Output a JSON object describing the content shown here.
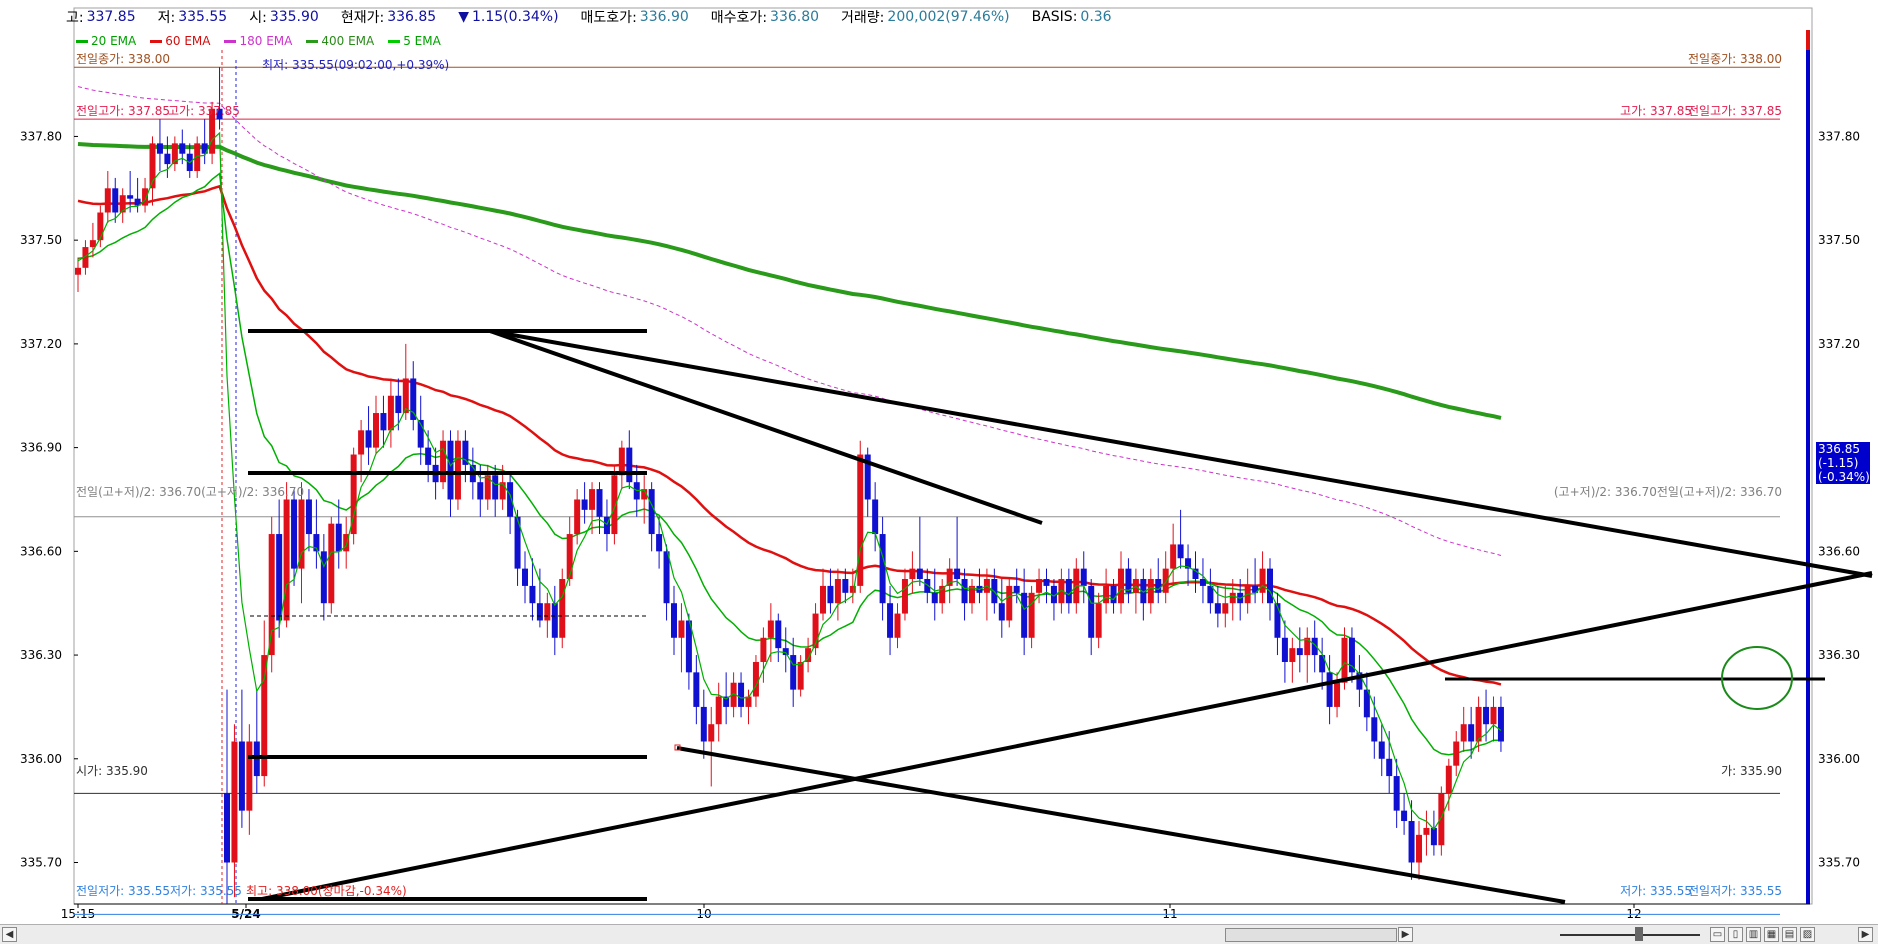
{
  "infobar": {
    "high_label": "고:",
    "high_value": "337.85",
    "low_label": "저:",
    "low_value": "335.55",
    "open_label": "시:",
    "open_value": "335.90",
    "current_label": "현재가:",
    "current_value": "336.85",
    "change_icon": "down-triangle-icon",
    "change_value": "1.15(0.34%)",
    "ask_label": "매도호가:",
    "ask_value": "336.90",
    "bid_label": "매수호가:",
    "bid_value": "336.80",
    "volume_label": "거래량:",
    "volume_value": "200,002(97.46%)",
    "basis_label": "BASIS:",
    "basis_value": "0.36"
  },
  "legend": [
    {
      "label": "20 EMA",
      "color": "#00b000"
    },
    {
      "label": "60 EMA",
      "color": "#e01010"
    },
    {
      "label": "180 EMA",
      "color": "#cc33cc"
    },
    {
      "label": "400 EMA",
      "color": "#2a9a1a"
    },
    {
      "label": "5 EMA",
      "color": "#00cc00"
    }
  ],
  "colors": {
    "up": "#e0101a",
    "down": "#1010d0",
    "ema20": "#00b000",
    "ema60": "#e01010",
    "ema180": "#cc33cc",
    "ema400": "#2a9a1a",
    "accent": "#0000cc"
  },
  "price_box": {
    "line1": "336.85",
    "line2": "(-1.15)",
    "line3": "(-0.34%)"
  },
  "annotations": {
    "min_marker": "최저: 335.55(09:02:00,+0.39%)",
    "prev_close_left": "전일종가: 338.00",
    "prev_close_right": "전일종가: 338.00",
    "prev_high_left": "전일고가: 337.85",
    "high_left": "고가: 337.85",
    "high_right": "고가: 337.85",
    "prev_high_right": "전일고가: 337.85",
    "mid_left": "전일(고+저)/2: 336.70(고+저)/2: 336.70",
    "mid_right": "(고+저)/2: 336.70전일(고+저)/2: 336.70",
    "open_left": "시가: 335.90",
    "open_right": "가: 335.90",
    "prev_low_left": "전일저가: 335.55",
    "low_left": "저가: 335.55",
    "max_label": "최고: 338.00(장마감,-0.34%)",
    "low_right": "저가: 335.55",
    "prev_low_right": "전일저가: 335.55"
  },
  "chart_data": {
    "type": "candlestick",
    "instrument_timeframe": "1-minute",
    "x_tick_labels": [
      "15:15",
      "5/24",
      "10",
      "11",
      "12"
    ],
    "y_tick_labels": [
      "337.80",
      "337.50",
      "337.20",
      "336.90",
      "336.60",
      "336.30",
      "336.00",
      "335.70"
    ],
    "ylim": [
      335.58,
      338.05
    ],
    "reference_lines": {
      "prev_close": 338.0,
      "high": 337.85,
      "mid": 336.7,
      "open": 335.9,
      "low": 335.55
    },
    "current_price": 336.85,
    "session_start_index": 20,
    "candles": [
      [
        337.4,
        337.45,
        337.35,
        337.42
      ],
      [
        337.42,
        337.5,
        337.4,
        337.48
      ],
      [
        337.48,
        337.55,
        337.45,
        337.5
      ],
      [
        337.5,
        337.6,
        337.48,
        337.58
      ],
      [
        337.58,
        337.7,
        337.55,
        337.65
      ],
      [
        337.65,
        337.68,
        337.55,
        337.58
      ],
      [
        337.58,
        337.65,
        337.55,
        337.63
      ],
      [
        337.63,
        337.7,
        337.58,
        337.62
      ],
      [
        337.62,
        337.68,
        337.58,
        337.6
      ],
      [
        337.6,
        337.68,
        337.58,
        337.65
      ],
      [
        337.65,
        337.8,
        337.6,
        337.78
      ],
      [
        337.78,
        337.85,
        337.7,
        337.75
      ],
      [
        337.75,
        337.8,
        337.68,
        337.72
      ],
      [
        337.72,
        337.8,
        337.7,
        337.78
      ],
      [
        337.78,
        337.82,
        337.72,
        337.75
      ],
      [
        337.75,
        337.78,
        337.68,
        337.7
      ],
      [
        337.7,
        337.8,
        337.68,
        337.78
      ],
      [
        337.78,
        337.85,
        337.72,
        337.75
      ],
      [
        337.75,
        337.9,
        337.72,
        337.88
      ],
      [
        337.88,
        338.0,
        337.82,
        337.85
      ],
      [
        335.9,
        336.2,
        335.58,
        335.7
      ],
      [
        335.7,
        336.1,
        335.6,
        336.05
      ],
      [
        336.05,
        336.2,
        335.8,
        335.85
      ],
      [
        335.85,
        336.1,
        335.78,
        336.05
      ],
      [
        336.05,
        336.2,
        335.9,
        335.95
      ],
      [
        335.95,
        336.4,
        335.92,
        336.3
      ],
      [
        336.3,
        336.7,
        336.25,
        336.65
      ],
      [
        336.65,
        336.75,
        336.35,
        336.4
      ],
      [
        336.4,
        336.8,
        336.38,
        336.75
      ],
      [
        336.75,
        336.78,
        336.5,
        336.55
      ],
      [
        336.55,
        336.8,
        336.45,
        336.75
      ],
      [
        336.75,
        336.78,
        336.6,
        336.65
      ],
      [
        336.65,
        336.75,
        336.55,
        336.6
      ],
      [
        336.6,
        336.65,
        336.4,
        336.45
      ],
      [
        336.45,
        336.7,
        336.42,
        336.68
      ],
      [
        336.68,
        336.75,
        336.55,
        336.6
      ],
      [
        336.6,
        336.7,
        336.55,
        336.65
      ],
      [
        336.65,
        336.9,
        336.62,
        336.88
      ],
      [
        336.88,
        336.98,
        336.8,
        336.95
      ],
      [
        336.95,
        337.02,
        336.85,
        336.9
      ],
      [
        336.9,
        337.05,
        336.88,
        337.0
      ],
      [
        337.0,
        337.05,
        336.9,
        336.95
      ],
      [
        336.95,
        337.1,
        336.9,
        337.05
      ],
      [
        337.05,
        337.1,
        336.95,
        337.0
      ],
      [
        337.0,
        337.2,
        336.98,
        337.1
      ],
      [
        337.1,
        337.15,
        336.95,
        336.98
      ],
      [
        336.98,
        337.05,
        336.85,
        336.9
      ],
      [
        336.9,
        336.95,
        336.8,
        336.85
      ],
      [
        336.85,
        336.9,
        336.75,
        336.8
      ],
      [
        336.8,
        336.95,
        336.78,
        336.92
      ],
      [
        336.92,
        336.95,
        336.7,
        336.75
      ],
      [
        336.75,
        336.95,
        336.72,
        336.92
      ],
      [
        336.92,
        336.95,
        336.8,
        336.85
      ],
      [
        336.85,
        336.9,
        336.75,
        336.8
      ],
      [
        336.8,
        336.85,
        336.7,
        336.75
      ],
      [
        336.75,
        336.85,
        336.72,
        336.82
      ],
      [
        336.82,
        336.85,
        336.7,
        336.75
      ],
      [
        336.75,
        336.85,
        336.72,
        336.8
      ],
      [
        336.8,
        336.82,
        336.65,
        336.7
      ],
      [
        336.7,
        336.72,
        336.5,
        336.55
      ],
      [
        336.55,
        336.6,
        336.45,
        336.5
      ],
      [
        336.5,
        336.58,
        336.4,
        336.45
      ],
      [
        336.45,
        336.55,
        336.38,
        336.4
      ],
      [
        336.4,
        336.48,
        336.35,
        336.45
      ],
      [
        336.45,
        336.5,
        336.3,
        336.35
      ],
      [
        336.35,
        336.55,
        336.32,
        336.52
      ],
      [
        336.52,
        336.7,
        336.5,
        336.65
      ],
      [
        336.65,
        336.78,
        336.62,
        336.75
      ],
      [
        336.75,
        336.8,
        336.68,
        336.72
      ],
      [
        336.72,
        336.8,
        336.65,
        336.78
      ],
      [
        336.78,
        336.8,
        336.65,
        336.7
      ],
      [
        336.7,
        336.75,
        336.6,
        336.65
      ],
      [
        336.65,
        336.85,
        336.62,
        336.82
      ],
      [
        336.82,
        336.92,
        336.78,
        336.9
      ],
      [
        336.9,
        336.95,
        336.78,
        336.8
      ],
      [
        336.8,
        336.85,
        336.7,
        336.75
      ],
      [
        336.75,
        336.82,
        336.68,
        336.78
      ],
      [
        336.78,
        336.8,
        336.6,
        336.65
      ],
      [
        336.65,
        336.7,
        336.55,
        336.6
      ],
      [
        336.6,
        336.62,
        336.4,
        336.45
      ],
      [
        336.45,
        336.5,
        336.3,
        336.35
      ],
      [
        336.35,
        336.45,
        336.25,
        336.4
      ],
      [
        336.4,
        336.42,
        336.2,
        336.25
      ],
      [
        336.25,
        336.3,
        336.1,
        336.15
      ],
      [
        336.15,
        336.2,
        336.0,
        336.05
      ],
      [
        336.05,
        336.15,
        335.92,
        336.1
      ],
      [
        336.1,
        336.22,
        336.05,
        336.18
      ],
      [
        336.18,
        336.25,
        336.1,
        336.15
      ],
      [
        336.15,
        336.25,
        336.12,
        336.22
      ],
      [
        336.22,
        336.25,
        336.12,
        336.15
      ],
      [
        336.15,
        336.2,
        336.1,
        336.18
      ],
      [
        336.18,
        336.3,
        336.15,
        336.28
      ],
      [
        336.28,
        336.38,
        336.22,
        336.35
      ],
      [
        336.35,
        336.45,
        336.28,
        336.4
      ],
      [
        336.4,
        336.42,
        336.28,
        336.32
      ],
      [
        336.32,
        336.38,
        336.25,
        336.3
      ],
      [
        336.3,
        336.35,
        336.15,
        336.2
      ],
      [
        336.2,
        336.3,
        336.18,
        336.28
      ],
      [
        336.28,
        336.35,
        336.25,
        336.32
      ],
      [
        336.32,
        336.45,
        336.3,
        336.42
      ],
      [
        336.42,
        336.55,
        336.4,
        336.5
      ],
      [
        336.5,
        336.55,
        336.42,
        336.45
      ],
      [
        336.45,
        336.55,
        336.4,
        336.52
      ],
      [
        336.52,
        336.55,
        336.45,
        336.48
      ],
      [
        336.48,
        336.55,
        336.45,
        336.5
      ],
      [
        336.5,
        336.92,
        336.48,
        336.88
      ],
      [
        336.88,
        336.9,
        336.7,
        336.75
      ],
      [
        336.75,
        336.8,
        336.6,
        336.65
      ],
      [
        336.65,
        336.7,
        336.4,
        336.45
      ],
      [
        336.45,
        336.5,
        336.3,
        336.35
      ],
      [
        336.35,
        336.45,
        336.32,
        336.42
      ],
      [
        336.42,
        336.55,
        336.4,
        336.52
      ],
      [
        336.52,
        336.6,
        336.48,
        336.55
      ],
      [
        336.55,
        336.7,
        336.5,
        336.52
      ],
      [
        336.52,
        336.55,
        336.45,
        336.48
      ],
      [
        336.48,
        336.55,
        336.4,
        336.45
      ],
      [
        336.45,
        336.52,
        336.42,
        336.5
      ],
      [
        336.5,
        336.58,
        336.45,
        336.55
      ],
      [
        336.55,
        336.7,
        336.5,
        336.52
      ],
      [
        336.52,
        336.55,
        336.4,
        336.45
      ],
      [
        336.45,
        336.52,
        336.42,
        336.5
      ],
      [
        336.5,
        336.55,
        336.45,
        336.48
      ],
      [
        336.48,
        336.55,
        336.4,
        336.52
      ],
      [
        336.52,
        336.55,
        336.42,
        336.45
      ],
      [
        336.45,
        336.52,
        336.35,
        336.4
      ],
      [
        336.4,
        336.52,
        336.38,
        336.5
      ],
      [
        336.5,
        336.55,
        336.45,
        336.48
      ],
      [
        336.48,
        336.55,
        336.3,
        336.35
      ],
      [
        336.35,
        336.5,
        336.32,
        336.48
      ],
      [
        336.48,
        336.55,
        336.45,
        336.52
      ],
      [
        336.52,
        336.55,
        336.45,
        336.5
      ],
      [
        336.5,
        336.52,
        336.4,
        336.45
      ],
      [
        336.45,
        336.55,
        336.42,
        336.52
      ],
      [
        336.52,
        336.55,
        336.42,
        336.45
      ],
      [
        336.45,
        336.58,
        336.42,
        336.55
      ],
      [
        336.55,
        336.6,
        336.45,
        336.5
      ],
      [
        336.5,
        336.52,
        336.3,
        336.35
      ],
      [
        336.35,
        336.48,
        336.32,
        336.45
      ],
      [
        336.45,
        336.55,
        336.42,
        336.5
      ],
      [
        336.5,
        336.52,
        336.42,
        336.45
      ],
      [
        336.45,
        336.6,
        336.42,
        336.55
      ],
      [
        336.55,
        336.58,
        336.45,
        336.48
      ],
      [
        336.48,
        336.55,
        336.42,
        336.52
      ],
      [
        336.52,
        336.55,
        336.4,
        336.45
      ],
      [
        336.45,
        336.55,
        336.42,
        336.52
      ],
      [
        336.52,
        336.58,
        336.45,
        336.48
      ],
      [
        336.48,
        336.6,
        336.45,
        336.55
      ],
      [
        336.55,
        336.68,
        336.5,
        336.62
      ],
      [
        336.62,
        336.72,
        336.55,
        336.58
      ],
      [
        336.58,
        336.62,
        336.5,
        336.55
      ],
      [
        336.55,
        336.6,
        336.48,
        336.52
      ],
      [
        336.52,
        336.58,
        336.45,
        336.5
      ],
      [
        336.5,
        336.55,
        336.42,
        336.45
      ],
      [
        336.45,
        336.5,
        336.38,
        336.42
      ],
      [
        336.42,
        336.5,
        336.38,
        336.45
      ],
      [
        336.45,
        336.52,
        336.4,
        336.48
      ],
      [
        336.48,
        336.52,
        336.4,
        336.45
      ],
      [
        336.45,
        336.55,
        336.42,
        336.5
      ],
      [
        336.5,
        336.58,
        336.45,
        336.48
      ],
      [
        336.48,
        336.6,
        336.45,
        336.55
      ],
      [
        336.55,
        336.58,
        336.4,
        336.45
      ],
      [
        336.45,
        336.48,
        336.3,
        336.35
      ],
      [
        336.35,
        336.4,
        336.22,
        336.28
      ],
      [
        336.28,
        336.35,
        336.22,
        336.32
      ],
      [
        336.32,
        336.38,
        336.25,
        336.3
      ],
      [
        336.3,
        336.38,
        336.22,
        336.35
      ],
      [
        336.35,
        336.4,
        336.25,
        336.3
      ],
      [
        336.3,
        336.35,
        336.2,
        336.25
      ],
      [
        336.25,
        336.3,
        336.1,
        336.15
      ],
      [
        336.15,
        336.25,
        336.12,
        336.22
      ],
      [
        336.22,
        336.38,
        336.2,
        336.35
      ],
      [
        336.35,
        336.38,
        336.22,
        336.25
      ],
      [
        336.25,
        336.3,
        336.15,
        336.2
      ],
      [
        336.2,
        336.25,
        336.08,
        336.12
      ],
      [
        336.12,
        336.18,
        336.0,
        336.05
      ],
      [
        336.05,
        336.1,
        335.95,
        336.0
      ],
      [
        336.0,
        336.08,
        335.9,
        335.95
      ],
      [
        335.95,
        336.0,
        335.8,
        335.85
      ],
      [
        335.85,
        335.9,
        335.78,
        335.82
      ],
      [
        335.82,
        335.88,
        335.65,
        335.7
      ],
      [
        335.7,
        335.82,
        335.65,
        335.78
      ],
      [
        335.78,
        335.85,
        335.72,
        335.8
      ],
      [
        335.8,
        335.85,
        335.72,
        335.75
      ],
      [
        335.75,
        335.92,
        335.72,
        335.9
      ],
      [
        335.9,
        336.0,
        335.85,
        335.98
      ],
      [
        335.98,
        336.08,
        335.95,
        336.05
      ],
      [
        336.05,
        336.15,
        336.02,
        336.1
      ],
      [
        336.1,
        336.15,
        336.0,
        336.05
      ],
      [
        336.05,
        336.18,
        336.02,
        336.15
      ],
      [
        336.15,
        336.2,
        336.05,
        336.1
      ],
      [
        336.1,
        336.18,
        336.05,
        336.15
      ],
      [
        336.15,
        336.18,
        336.02,
        336.05
      ]
    ]
  }
}
